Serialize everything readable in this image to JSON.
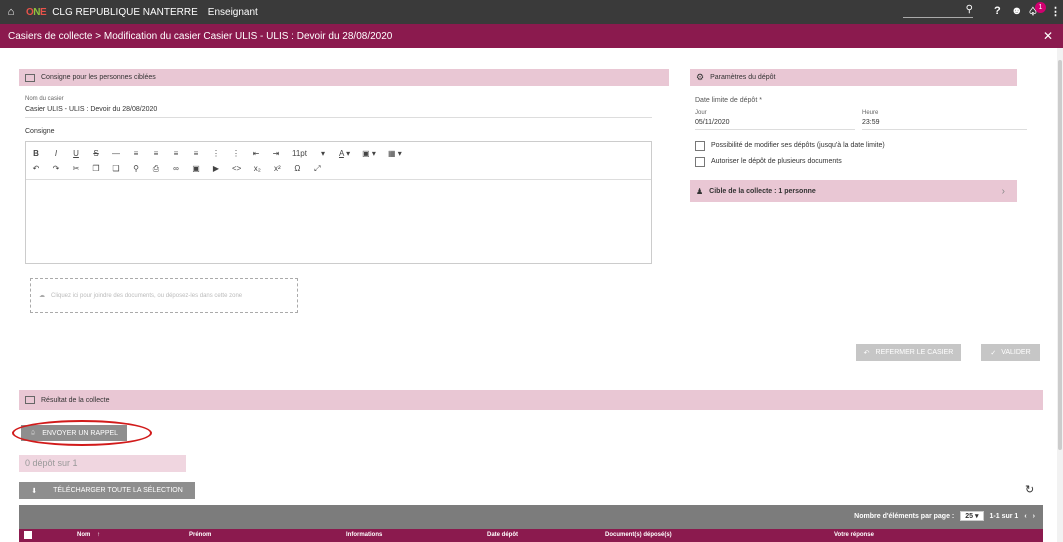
{
  "topbar": {
    "school": "CLG REPUBLIQUE NANTERRE",
    "role": "Enseignant",
    "notification_count": "1"
  },
  "titlebar": {
    "title": "Casiers de collecte > Modification du casier Casier ULIS - ULIS : Devoir du 28/08/2020"
  },
  "consigne_panel": {
    "header": "Consigne pour les personnes ciblées",
    "name_label": "Nom du casier",
    "name_value": "Casier ULIS - ULIS : Devoir du 28/08/2020",
    "consigne_label": "Consigne",
    "font_size": "11pt",
    "dropzone_text": "Cliquez ici pour joindre des documents, ou déposez-les dans cette zone"
  },
  "params_panel": {
    "header": "Paramètres du dépôt",
    "deadline_label": "Date limite de dépôt *",
    "day_label": "Jour",
    "day_value": "05/11/2020",
    "hour_label": "Heure",
    "hour_value": "23:59",
    "option1": "Possibilité de modifier ses dépôts (jusqu'à la date limite)",
    "option2": "Autoriser le dépôt de plusieurs documents",
    "target": "Cible de la collecte : 1 personne"
  },
  "actions": {
    "close_label": "REFERMER LE CASIER",
    "validate_label": "VALIDER"
  },
  "results": {
    "header": "Résultat de la collecte",
    "reminder_label": "ENVOYER UN RAPPEL",
    "count_text": "0 dépôt sur 1",
    "download_label": "TÉLÉCHARGER TOUTE LA SÉLECTION",
    "per_page_label": "Nombre d'éléments par page :",
    "per_page_value": "25",
    "range": "1-1 sur 1",
    "columns": [
      "Nom",
      "Prénom",
      "Informations",
      "Date dépôt",
      "Document(s) déposé(s)",
      "Votre réponse"
    ]
  }
}
